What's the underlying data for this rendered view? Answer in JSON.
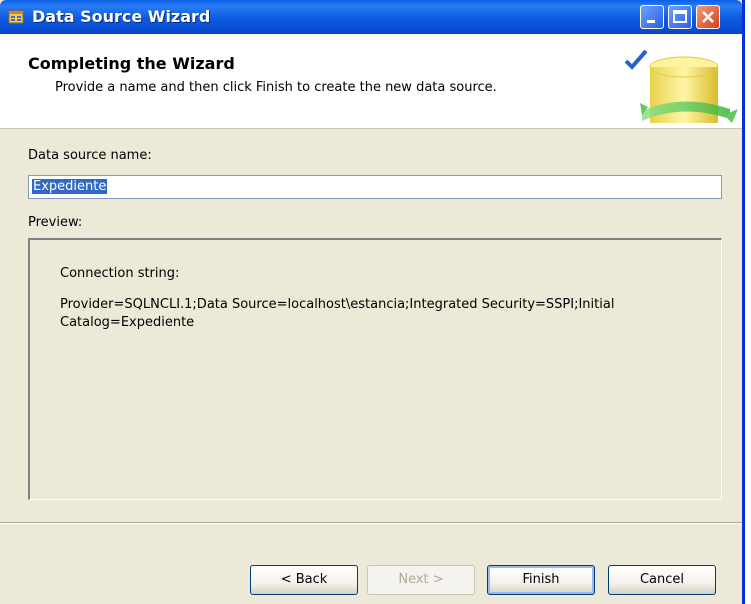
{
  "window": {
    "title": "Data Source Wizard"
  },
  "header": {
    "title": "Completing the Wizard",
    "subtitle": "Provide a name and then click Finish to create the new data source."
  },
  "form": {
    "name_label": "Data source name:",
    "name_value": "Expediente",
    "preview_label": "Preview:"
  },
  "preview": {
    "connection_label": "Connection string:",
    "connection_string": "Provider=SQLNCLI.1;Data Source=localhost\\estancia;Integrated Security=SSPI;Initial Catalog=Expediente"
  },
  "buttons": {
    "back": "< Back",
    "next": "Next >",
    "finish": "Finish",
    "cancel": "Cancel"
  },
  "colors": {
    "titlebar": "#0a5fe6",
    "dialog_bg": "#ece9d8",
    "selection": "#316ac5"
  },
  "icons": {
    "app": "data-source-icon",
    "minimize": "minimize-icon",
    "maximize": "maximize-icon",
    "close": "close-icon",
    "header": "database-check-icon"
  }
}
